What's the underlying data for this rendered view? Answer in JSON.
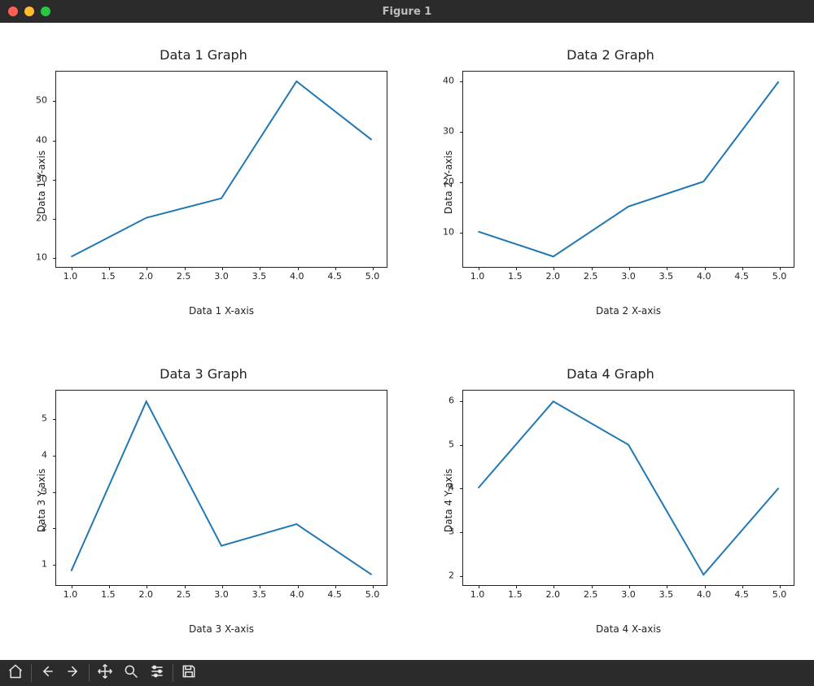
{
  "window": {
    "title": "Figure 1"
  },
  "toolbar": {
    "home": "Home",
    "back": "Back",
    "forward": "Forward",
    "pan": "Pan",
    "zoom": "Zoom",
    "configure": "Configure subplots",
    "save": "Save"
  },
  "chart_data": [
    {
      "type": "line",
      "title": "Data 1 Graph",
      "xlabel": "Data 1 X-axis",
      "ylabel": "Data 1 Y-axis",
      "x": [
        1,
        2,
        3,
        4,
        5
      ],
      "y": [
        10,
        20,
        25,
        55,
        40
      ],
      "xticks": [
        1.0,
        1.5,
        2.0,
        2.5,
        3.0,
        3.5,
        4.0,
        4.5,
        5.0
      ],
      "yticks": [
        10,
        20,
        30,
        40,
        50
      ],
      "xlim": [
        0.8,
        5.2
      ],
      "ylim": [
        7.5,
        57.5
      ]
    },
    {
      "type": "line",
      "title": "Data 2 Graph",
      "xlabel": "Data 2 X-axis",
      "ylabel": "Data 2 Y-axis",
      "x": [
        1,
        2,
        3,
        4,
        5
      ],
      "y": [
        10,
        5,
        15,
        20,
        40
      ],
      "xticks": [
        1.0,
        1.5,
        2.0,
        2.5,
        3.0,
        3.5,
        4.0,
        4.5,
        5.0
      ],
      "yticks": [
        10,
        20,
        30,
        40
      ],
      "xlim": [
        0.8,
        5.2
      ],
      "ylim": [
        3,
        42
      ]
    },
    {
      "type": "line",
      "title": "Data 3 Graph",
      "xlabel": "Data 3 X-axis",
      "ylabel": "Data 3 Y-axis",
      "x": [
        1,
        2,
        3,
        4,
        5
      ],
      "y": [
        0.8,
        5.5,
        1.5,
        2.1,
        0.7
      ],
      "xticks": [
        1.0,
        1.5,
        2.0,
        2.5,
        3.0,
        3.5,
        4.0,
        4.5,
        5.0
      ],
      "yticks": [
        1,
        2,
        3,
        4,
        5
      ],
      "xlim": [
        0.8,
        5.2
      ],
      "ylim": [
        0.4,
        5.8
      ]
    },
    {
      "type": "line",
      "title": "Data 4 Graph",
      "xlabel": "Data 4 X-axis",
      "ylabel": "Data 4 Y-axis",
      "x": [
        1,
        2,
        3,
        4,
        5
      ],
      "y": [
        4,
        6,
        5,
        2,
        4
      ],
      "xticks": [
        1.0,
        1.5,
        2.0,
        2.5,
        3.0,
        3.5,
        4.0,
        4.5,
        5.0
      ],
      "yticks": [
        2,
        3,
        4,
        5,
        6
      ],
      "xlim": [
        0.8,
        5.2
      ],
      "ylim": [
        1.75,
        6.25
      ]
    }
  ]
}
